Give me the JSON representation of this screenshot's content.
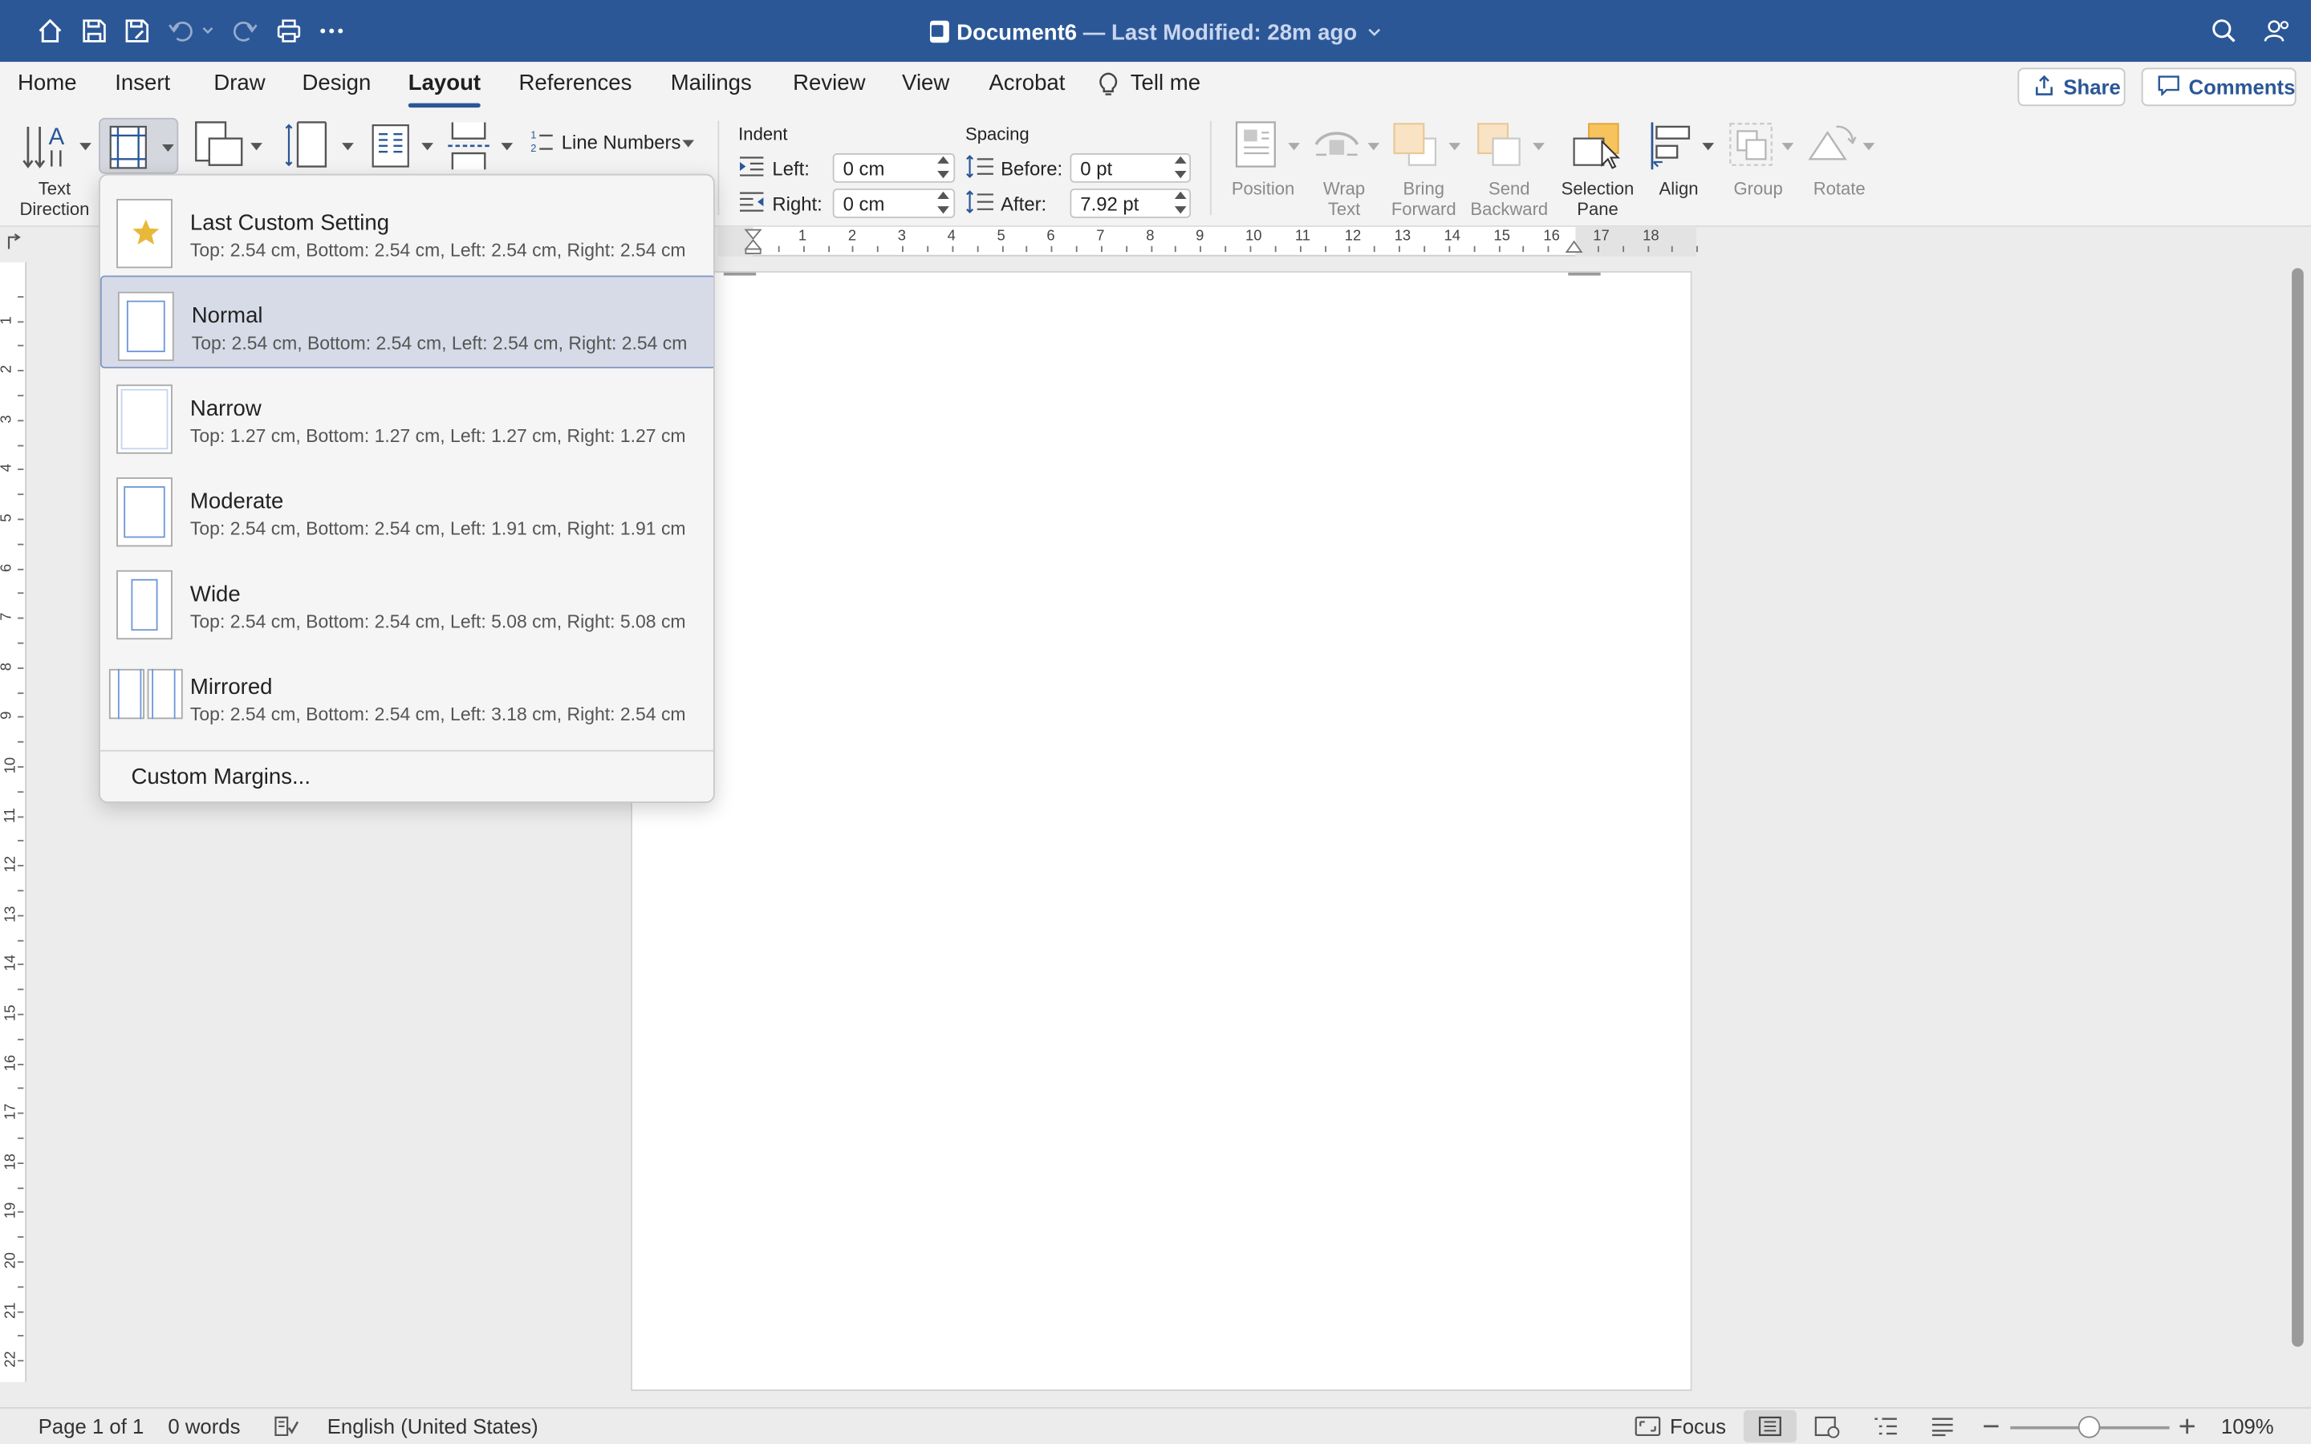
{
  "window": {
    "title": "Document6",
    "subtitle": "— Last Modified: 28m ago"
  },
  "tabs": [
    "Home",
    "Insert",
    "Draw",
    "Design",
    "Layout",
    "References",
    "Mailings",
    "Review",
    "View",
    "Acrobat"
  ],
  "active_tab": "Layout",
  "tell_me": "Tell me",
  "share_label": "Share",
  "comments_label": "Comments",
  "ribbon": {
    "text_direction": "Text\nDirection",
    "line_numbers": "Line Numbers",
    "indent_heading": "Indent",
    "indent_left_label": "Left:",
    "indent_left_value": "0 cm",
    "indent_right_label": "Right:",
    "indent_right_value": "0 cm",
    "spacing_heading": "Spacing",
    "spacing_before_label": "Before:",
    "spacing_before_value": "0 pt",
    "spacing_after_label": "After:",
    "spacing_after_value": "7.92 pt",
    "position": "Position",
    "wrap_text": "Wrap\nText",
    "bring_forward": "Bring\nForward",
    "send_backward": "Send\nBackward",
    "selection_pane": "Selection\nPane",
    "align": "Align",
    "group": "Group",
    "rotate": "Rotate"
  },
  "margins_menu": {
    "items": [
      {
        "name": "Last Custom Setting",
        "desc": "Top: 2.54 cm, Bottom: 2.54 cm, Left: 2.54 cm, Right: 2.54 cm"
      },
      {
        "name": "Normal",
        "desc": "Top: 2.54 cm, Bottom: 2.54 cm, Left: 2.54 cm, Right: 2.54 cm"
      },
      {
        "name": "Narrow",
        "desc": "Top: 1.27 cm, Bottom: 1.27 cm, Left: 1.27 cm, Right: 1.27 cm"
      },
      {
        "name": "Moderate",
        "desc": "Top: 2.54 cm, Bottom: 2.54 cm, Left: 1.91 cm, Right: 1.91 cm"
      },
      {
        "name": "Wide",
        "desc": "Top: 2.54 cm, Bottom: 2.54 cm, Left: 5.08 cm, Right: 5.08 cm"
      },
      {
        "name": "Mirrored",
        "desc": "Top: 2.54 cm, Bottom: 2.54 cm, Left: 3.18 cm, Right: 2.54 cm"
      }
    ],
    "selected": "Normal",
    "custom_label": "Custom Margins..."
  },
  "ruler": {
    "h_numbers": [
      "1",
      "2",
      "3",
      "4",
      "5",
      "6",
      "7",
      "8",
      "9",
      "10",
      "11",
      "12",
      "13",
      "14",
      "15",
      "16",
      "17",
      "18"
    ],
    "v_numbers": [
      "1",
      "2",
      "3",
      "4",
      "5",
      "6",
      "7",
      "8",
      "9",
      "10",
      "11",
      "12",
      "13",
      "14",
      "15",
      "16",
      "17",
      "18",
      "19",
      "20",
      "21",
      "22"
    ]
  },
  "status": {
    "page": "Page 1 of 1",
    "words": "0 words",
    "language": "English (United States)",
    "focus": "Focus",
    "zoom": "109%"
  },
  "colors": {
    "titlebar": "#2b5797",
    "accent": "#2b5797",
    "star": "#e8b83a"
  }
}
